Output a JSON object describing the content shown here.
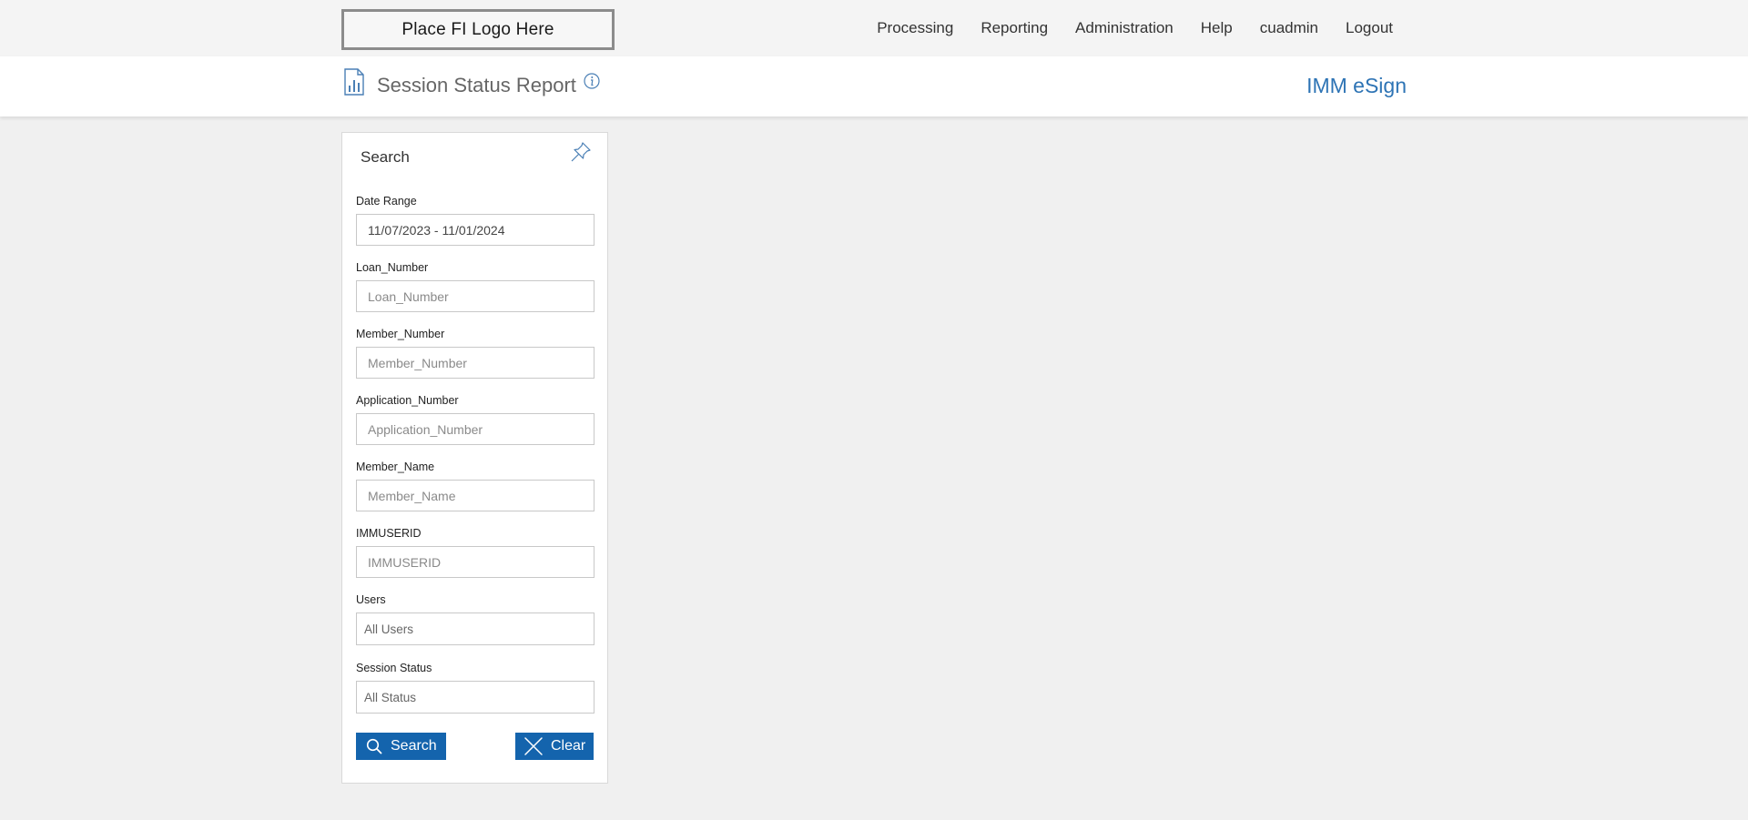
{
  "header": {
    "logo_text": "Place FI Logo Here",
    "nav": [
      {
        "label": "Processing"
      },
      {
        "label": "Reporting"
      },
      {
        "label": "Administration"
      },
      {
        "label": "Help"
      },
      {
        "label": "cuadmin"
      },
      {
        "label": "Logout"
      }
    ]
  },
  "titlebar": {
    "icon": "bar-chart-report-icon",
    "title": "Session Status Report",
    "info_icon": "info-icon",
    "product": "IMM eSign"
  },
  "search_panel": {
    "title": "Search",
    "pin_icon": "pin-icon",
    "fields": {
      "date_range": {
        "label": "Date Range",
        "value": "11/07/2023 - 11/01/2024",
        "placeholder": ""
      },
      "loan_number": {
        "label": "Loan_Number",
        "value": "",
        "placeholder": "Loan_Number"
      },
      "member_number": {
        "label": "Member_Number",
        "value": "",
        "placeholder": "Member_Number"
      },
      "application_number": {
        "label": "Application_Number",
        "value": "",
        "placeholder": "Application_Number"
      },
      "member_name": {
        "label": "Member_Name",
        "value": "",
        "placeholder": "Member_Name"
      },
      "immuserid": {
        "label": "IMMUSERID",
        "value": "",
        "placeholder": "IMMUSERID"
      },
      "users": {
        "label": "Users",
        "selected": "All Users"
      },
      "session_status": {
        "label": "Session Status",
        "selected": "All Status"
      }
    },
    "buttons": {
      "search": {
        "label": "Search",
        "icon": "search-icon"
      },
      "clear": {
        "label": "Clear",
        "icon": "close-icon"
      }
    }
  },
  "colors": {
    "accent": "#1464ad",
    "product_text": "#2e74b5",
    "background": "#f0f0f0"
  }
}
